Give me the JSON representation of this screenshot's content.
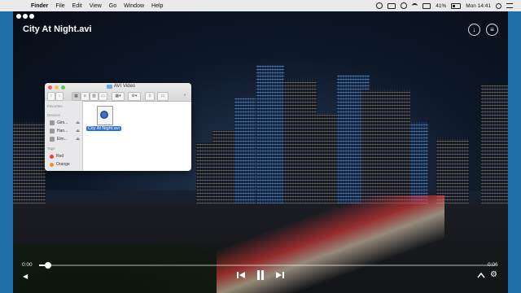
{
  "menubar": {
    "apple_glyph": "",
    "app_name": "Finder",
    "menus": [
      "File",
      "Edit",
      "View",
      "Go",
      "Window",
      "Help"
    ],
    "battery": "41%",
    "clock": "Mon 14:41"
  },
  "player": {
    "title": "City At Night.avi",
    "time_elapsed": "0:00",
    "time_total": "0:06",
    "progress_fraction": 0.02
  },
  "finder": {
    "title": "AVI Video",
    "favorites_header": "Favorites",
    "devices_header": "Devices",
    "devices": [
      "Gim...",
      "Han...",
      "Elm..."
    ],
    "tags_header": "Tags",
    "tags": [
      {
        "label": "Red",
        "color": "#e0443a"
      },
      {
        "label": "Orange",
        "color": "#f0902a"
      }
    ],
    "file_name": "City At Night.avi"
  },
  "colors": {
    "desktop": "#1f6fa8",
    "selection": "#2f6fd6"
  }
}
